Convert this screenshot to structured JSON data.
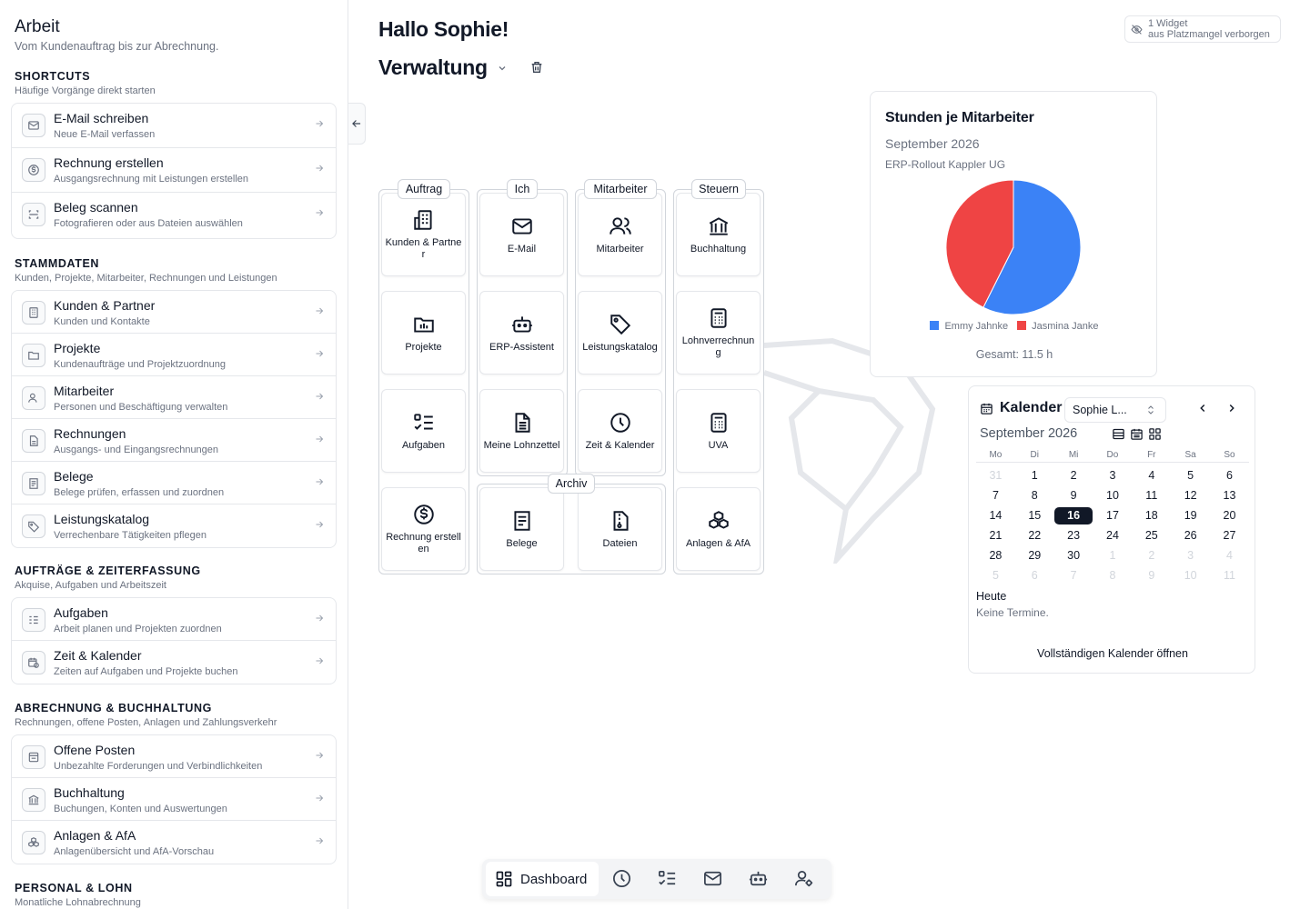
{
  "sidebar": {
    "title": "Arbeit",
    "subtitle": "Vom Kundenauftrag bis zur Abrechnung.",
    "sections": [
      {
        "heading": "SHORTCUTS",
        "sub": "Häufige Vorgänge direkt starten",
        "items": [
          {
            "title": "E-Mail schreiben",
            "desc": "Neue E-Mail verfassen",
            "icon": "mail-icon"
          },
          {
            "title": "Rechnung erstellen",
            "desc": "Ausgangsrechnung mit Leistungen erstellen",
            "icon": "dollar-circle-icon"
          },
          {
            "title": "Beleg scannen",
            "desc": "Fotografieren oder aus Dateien auswählen",
            "icon": "scan-icon"
          }
        ]
      },
      {
        "heading": "STAMMDATEN",
        "sub": "Kunden, Projekte, Mitarbeiter, Rechnungen und Leistungen",
        "items": [
          {
            "title": "Kunden & Partner",
            "desc": "Kunden und Kontakte",
            "icon": "building-icon"
          },
          {
            "title": "Projekte",
            "desc": "Kundenaufträge und Projektzuordnung",
            "icon": "folder-icon"
          },
          {
            "title": "Mitarbeiter",
            "desc": "Personen und Beschäftigung verwalten",
            "icon": "users-icon"
          },
          {
            "title": "Rechnungen",
            "desc": "Ausgangs- und Eingangsrechnungen",
            "icon": "document-icon"
          },
          {
            "title": "Belege",
            "desc": "Belege prüfen, erfassen und zuordnen",
            "icon": "receipt-icon"
          },
          {
            "title": "Leistungskatalog",
            "desc": "Verrechenbare Tätigkeiten pflegen",
            "icon": "tag-icon"
          }
        ]
      },
      {
        "heading": "AUFTRÄGE & ZEITERFASSUNG",
        "sub": "Akquise, Aufgaben und Arbeitszeit",
        "items": [
          {
            "title": "Aufgaben",
            "desc": "Arbeit planen und Projekten zuordnen",
            "icon": "tasks-icon"
          },
          {
            "title": "Zeit & Kalender",
            "desc": "Zeiten auf Aufgaben und Projekte buchen",
            "icon": "calendar-clock-icon"
          }
        ]
      },
      {
        "heading": "ABRECHNUNG & BUCHHALTUNG",
        "sub": "Rechnungen, offene Posten, Anlagen und Zahlungsverkehr",
        "items": [
          {
            "title": "Offene Posten",
            "desc": "Unbezahlte Forderungen und Verbindlichkeiten",
            "icon": "invoice-icon"
          },
          {
            "title": "Buchhaltung",
            "desc": "Buchungen, Konten und Auswertungen",
            "icon": "bank-icon"
          },
          {
            "title": "Anlagen & AfA",
            "desc": "Anlagenübersicht und AfA-Vorschau",
            "icon": "boxes-icon"
          }
        ]
      },
      {
        "heading": "PERSONAL & LOHN",
        "sub": "Monatliche Lohnabrechnung",
        "items": []
      }
    ]
  },
  "main": {
    "greeting": "Hallo Sophie!",
    "dashboard_name": "Verwaltung",
    "hidden_widget_note_1": "1 Widget",
    "hidden_widget_note_2": "aus Platzmangel verborgen"
  },
  "groups": {
    "auftrag": "Auftrag",
    "ich": "Ich",
    "mitarbeiter": "Mitarbeiter",
    "steuern": "Steuern",
    "archiv": "Archiv"
  },
  "tiles": {
    "kunden": "Kunden & Partner",
    "projekte": "Projekte",
    "aufgaben": "Aufgaben",
    "rechnung": "Rechnung erstellen",
    "email": "E-Mail",
    "erp": "ERP-Assistent",
    "lohnzettel": "Meine Lohnzettel",
    "mitarbeiter": "Mitarbeiter",
    "leistungskatalog": "Leistungskatalog",
    "zeit": "Zeit & Kalender",
    "buchhaltung": "Buchhaltung",
    "lohnverrechnung": "Lohnverrechnung",
    "uva": "UVA",
    "belege": "Belege",
    "dateien": "Dateien",
    "anlagen": "Anlagen & AfA"
  },
  "chart_data": {
    "type": "pie",
    "title": "Stunden je Mitarbeiter",
    "subtitle": "September 2026",
    "project": "ERP-Rollout Kappler UG",
    "series": [
      {
        "name": "Emmy Jahnke",
        "value": 6.6,
        "color": "#3b82f6"
      },
      {
        "name": "Jasmina Janke",
        "value": 4.9,
        "color": "#ef4444"
      }
    ],
    "total_label": "Gesamt: 11.5 h"
  },
  "calendar": {
    "title": "Kalender",
    "person": "Sophie L...",
    "month": "September 2026",
    "weekdays": [
      "Mo",
      "Di",
      "Mi",
      "Do",
      "Fr",
      "Sa",
      "So"
    ],
    "weeks": [
      [
        "31",
        "1",
        "2",
        "3",
        "4",
        "5",
        "6"
      ],
      [
        "7",
        "8",
        "9",
        "10",
        "11",
        "12",
        "13"
      ],
      [
        "14",
        "15",
        "16",
        "17",
        "18",
        "19",
        "20"
      ],
      [
        "21",
        "22",
        "23",
        "24",
        "25",
        "26",
        "27"
      ],
      [
        "28",
        "29",
        "30",
        "1",
        "2",
        "3",
        "4"
      ],
      [
        "5",
        "6",
        "7",
        "8",
        "9",
        "10",
        "11"
      ]
    ],
    "today_label": "Heute",
    "no_events": "Keine Termine.",
    "open_full": "Vollständigen Kalender öffnen"
  },
  "bottom_nav": {
    "active_label": "Dashboard"
  }
}
